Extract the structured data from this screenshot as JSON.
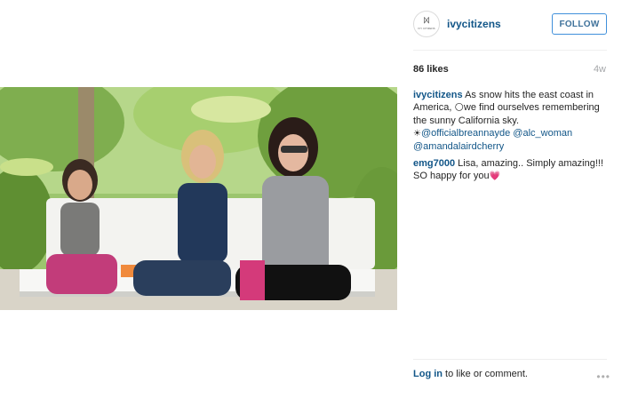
{
  "post": {
    "author": "ivycitizens",
    "follow_label": "FOLLOW",
    "likes": "86 likes",
    "age": "4w",
    "avatar_logo_text": "IVY CITIZENS",
    "caption": {
      "user": "ivycitizens",
      "text_1": "As snow hits the east coast in America,",
      "emoji_1": "🌕",
      "text_2": "we find ourselves remembering the sunny California sky.",
      "emoji_2": "☀",
      "mention_1": "@officialbreannayde",
      "mention_2": "@alc_woman",
      "mention_3": "@amandalairdcherry"
    },
    "comment": {
      "user": "emg7000",
      "text": "Lisa, amazing.. Simply amazing!!! SO happy for you",
      "emoji": "💗"
    },
    "footer": {
      "login_label": "Log in",
      "rest_text": " to like or comment.",
      "more_glyph": "•••"
    }
  },
  "icons": [
    "ivy-logo-icon",
    "more-options-icon",
    "moon-emoji-icon",
    "sun-emoji-icon",
    "heart-emoji-icon"
  ],
  "colors": {
    "link_blue": "#125688",
    "follow_border": "#4090db",
    "follow_text": "#3f729b",
    "muted_text": "#a5a7aa",
    "divider": "#efefef"
  }
}
